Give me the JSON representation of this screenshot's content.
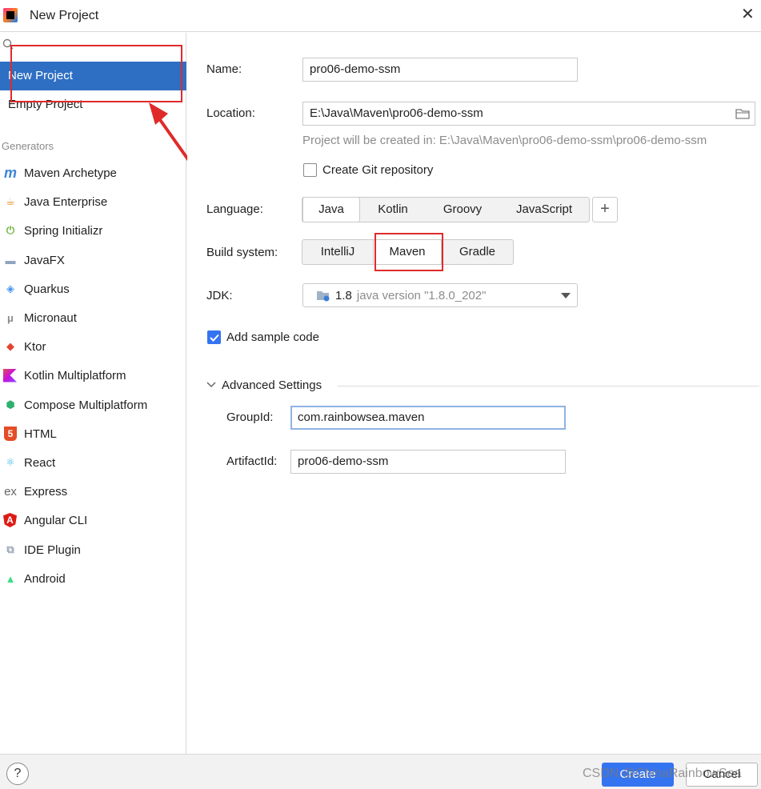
{
  "window": {
    "title": "New Project"
  },
  "sidebar": {
    "items": [
      {
        "label": "New Project",
        "selected": true
      },
      {
        "label": "Empty Project",
        "selected": false
      }
    ],
    "section_label": "Generators",
    "generators": [
      {
        "label": "Maven Archetype",
        "icon": "maven-icon",
        "glyph": "m",
        "color": "#3e86d6"
      },
      {
        "label": "Java Enterprise",
        "icon": "java-enterprise-icon",
        "glyph": "☕",
        "color": "#e8861c"
      },
      {
        "label": "Spring Initializr",
        "icon": "spring-icon",
        "glyph": "⏻",
        "color": "#6db33f"
      },
      {
        "label": "JavaFX",
        "icon": "javafx-icon",
        "glyph": "▬",
        "color": "#8fa3bf"
      },
      {
        "label": "Quarkus",
        "icon": "quarkus-icon",
        "glyph": "◈",
        "color": "#4695eb"
      },
      {
        "label": "Micronaut",
        "icon": "micronaut-icon",
        "glyph": "μ",
        "color": "#8a8a8a"
      },
      {
        "label": "Ktor",
        "icon": "ktor-icon",
        "glyph": "◆",
        "color": "#e3442e"
      },
      {
        "label": "Kotlin Multiplatform",
        "icon": "kotlin-icon",
        "glyph": "K",
        "color": "#8a63d2"
      },
      {
        "label": "Compose Multiplatform",
        "icon": "compose-icon",
        "glyph": "⬢",
        "color": "#2fb06f"
      },
      {
        "label": "HTML",
        "icon": "html5-icon",
        "glyph": "5",
        "color": "#e44d26"
      },
      {
        "label": "React",
        "icon": "react-icon",
        "glyph": "⚛",
        "color": "#3fb6e0"
      },
      {
        "label": "Express",
        "icon": "express-icon",
        "glyph": "ex",
        "color": "#666666"
      },
      {
        "label": "Angular CLI",
        "icon": "angular-icon",
        "glyph": "A",
        "color": "#dd1b16"
      },
      {
        "label": "IDE Plugin",
        "icon": "plugin-icon",
        "glyph": "⧉",
        "color": "#9aa7b8"
      },
      {
        "label": "Android",
        "icon": "android-icon",
        "glyph": "▲",
        "color": "#3ddc84"
      }
    ]
  },
  "form": {
    "name_label": "Name:",
    "name_value": "pro06-demo-ssm",
    "location_label": "Location:",
    "location_value": "E:\\Java\\Maven\\pro06-demo-ssm",
    "location_hint": "Project will be created in: E:\\Java\\Maven\\pro06-demo-ssm\\pro06-demo-ssm",
    "git_label": "Create Git repository",
    "git_checked": false,
    "language_label": "Language:",
    "languages": [
      "Java",
      "Kotlin",
      "Groovy",
      "JavaScript"
    ],
    "language_selected": "Java",
    "add_language": "+",
    "build_label": "Build system:",
    "build_systems": [
      "IntelliJ",
      "Maven",
      "Gradle"
    ],
    "build_selected": "Maven",
    "jdk_label": "JDK:",
    "jdk_version": "1.8",
    "jdk_detail": "java version \"1.8.0_202\"",
    "sample_label": "Add sample code",
    "sample_checked": true,
    "advanced_label": "Advanced Settings",
    "groupid_label": "GroupId:",
    "groupid_value": "com.rainbowsea.maven",
    "artifactid_label": "ArtifactId:",
    "artifactid_value": "pro06-demo-ssm"
  },
  "footer": {
    "help": "?",
    "create": "Create",
    "cancel": "Cancel"
  },
  "watermark": "CSDN @ChinaRainbowSea",
  "colors": {
    "selection": "#2f6fc3",
    "primary_button": "#3574f0",
    "annotation": "#e02a2a"
  }
}
